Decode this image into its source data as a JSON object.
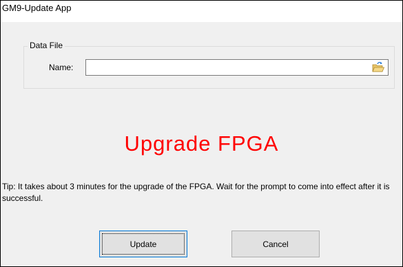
{
  "window": {
    "title": "GM9-Update App"
  },
  "data_file": {
    "group_label": "Data File",
    "name_label": "Name:",
    "name_value": "",
    "browse_icon": "open-folder-icon"
  },
  "heading": "Upgrade FPGA",
  "tip": "Tip: It takes about 3 minutes for the upgrade of the FPGA. Wait for the prompt to come into effect after it is successful.",
  "buttons": {
    "update_label": "Update",
    "cancel_label": "Cancel"
  },
  "colors": {
    "heading": "#ff0000",
    "window_bg": "#f0f0f0",
    "focus_border": "#0078d7"
  }
}
